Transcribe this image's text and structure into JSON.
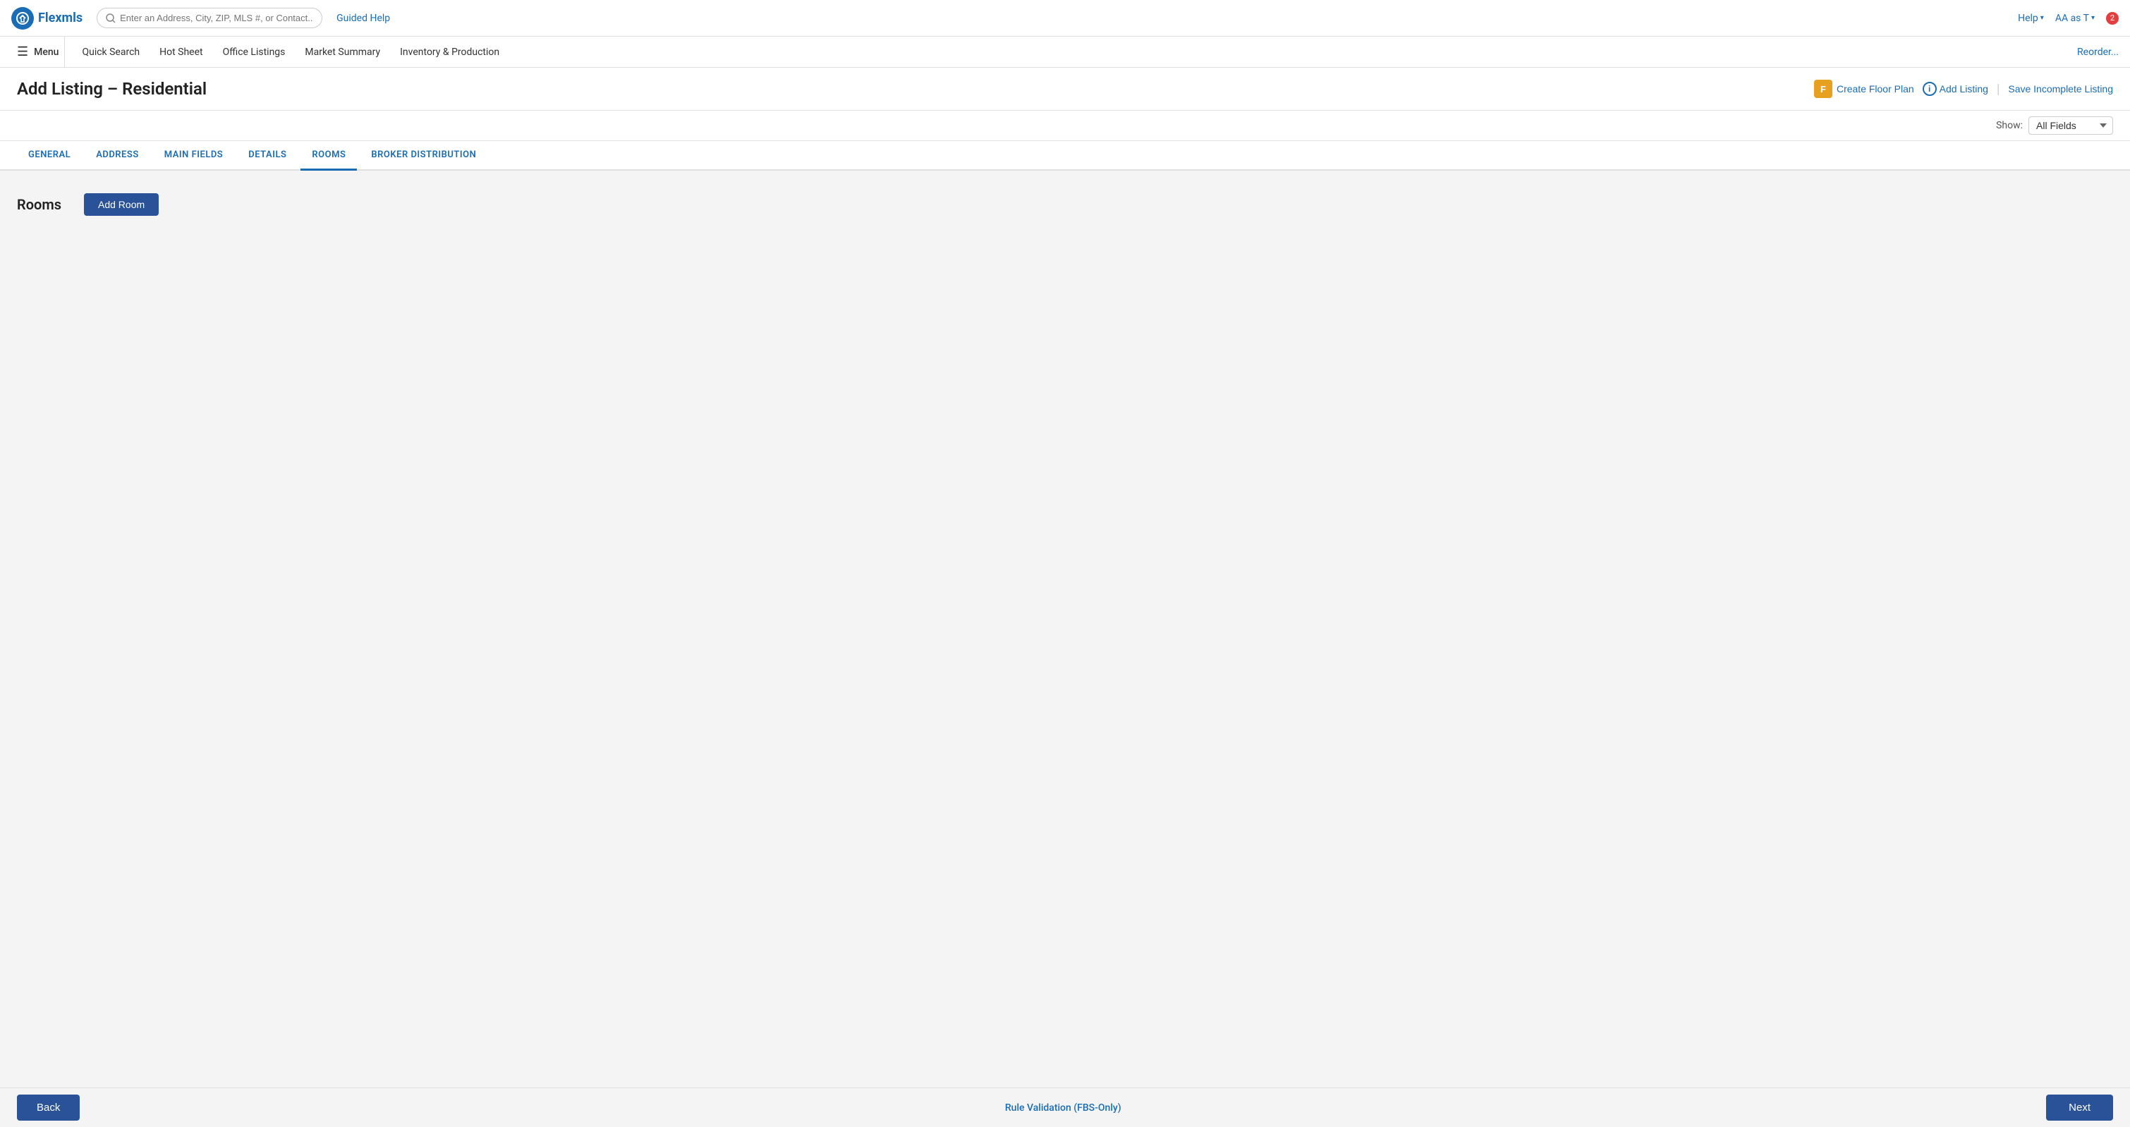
{
  "topNav": {
    "logoText": "Flexmls",
    "searchPlaceholder": "Enter an Address, City, ZIP, MLS #, or Contact...",
    "guidedHelp": "Guided Help",
    "help": "Help",
    "user": "AA as T",
    "notificationCount": "2"
  },
  "secondNav": {
    "menuLabel": "Menu",
    "links": [
      "Quick Search",
      "Hot Sheet",
      "Office Listings",
      "Market Summary",
      "Inventory & Production"
    ],
    "reorder": "Reorder..."
  },
  "pageHeader": {
    "title": "Add Listing – Residential",
    "createFloorPlan": "Create Floor Plan",
    "addListing": "Add Listing",
    "saveIncompleteListing": "Save Incomplete Listing"
  },
  "showFilter": {
    "label": "Show:",
    "value": "All Fields"
  },
  "tabs": [
    {
      "id": "general",
      "label": "GENERAL",
      "active": false
    },
    {
      "id": "address",
      "label": "ADDRESS",
      "active": false
    },
    {
      "id": "main-fields",
      "label": "MAIN FIELDS",
      "active": false
    },
    {
      "id": "details",
      "label": "DETAILS",
      "active": false
    },
    {
      "id": "rooms",
      "label": "ROOMS",
      "active": true
    },
    {
      "id": "broker-distribution",
      "label": "BROKER DISTRIBUTION",
      "active": false
    }
  ],
  "rooms": {
    "title": "Rooms",
    "addRoomLabel": "Add Room"
  },
  "bottomBar": {
    "back": "Back",
    "ruleValidation": "Rule Validation (FBS-Only)",
    "next": "Next"
  }
}
